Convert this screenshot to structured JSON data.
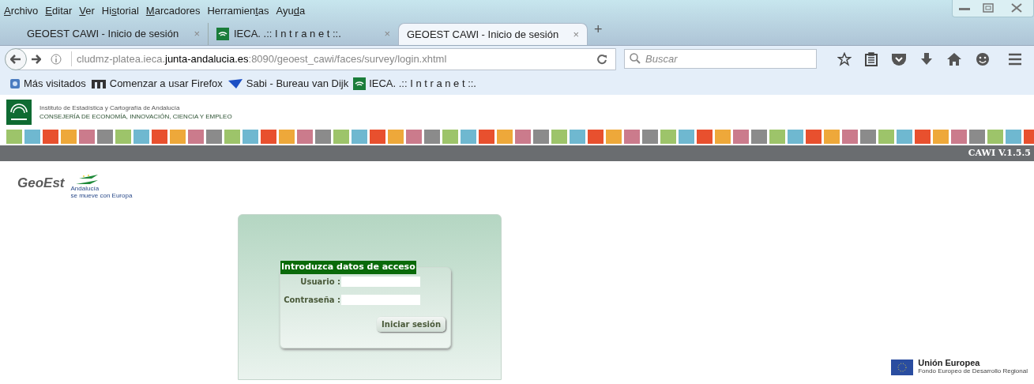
{
  "menu_bar": [
    {
      "accel": "A",
      "after": "rchivo"
    },
    {
      "accel": "E",
      "after": "ditar"
    },
    {
      "accel": "V",
      "after": "er"
    },
    {
      "before": "Hi",
      "accel": "s",
      "after": "torial"
    },
    {
      "accel": "M",
      "after": "arcadores"
    },
    {
      "before": "Herramien",
      "accel": "t",
      "after": "as"
    },
    {
      "before": "Ayu",
      "accel": "d",
      "after": "a"
    }
  ],
  "tabs": [
    {
      "title": "GEOEST CAWI - Inicio de sesión",
      "close": "×",
      "favicon": false,
      "selected": false
    },
    {
      "title": "IECA. .:: I n t r a n e t ::.",
      "close": "×",
      "favicon": true,
      "selected": false
    },
    {
      "title": "GEOEST CAWI - Inicio de sesión",
      "close": "×",
      "favicon": false,
      "selected": true
    }
  ],
  "new_tab": "+",
  "address": {
    "host_prefix": "cludmz-platea.ieca.",
    "domain": "junta-andalucia.es",
    "path": ":8090/geoest_cawi/faces/survey/login.xhtml"
  },
  "search": {
    "placeholder": "Buscar"
  },
  "bookmarks": [
    {
      "label": "Más visitados",
      "kind": "folder"
    },
    {
      "label": "Comenzar a usar Firefox",
      "kind": "m"
    },
    {
      "label": "Sabi - Bureau van Dijk",
      "kind": "sabi"
    },
    {
      "label": "IECA. .:: I n t r a n e t ::.",
      "kind": "ieca"
    }
  ],
  "header": {
    "institute": "Instituto de Estadística y Cartografía de Andalucía",
    "ministry": "CONSEJERÍA DE ECONOMÍA, INNOVACIÓN, CIENCIA Y EMPLEO",
    "version": "CAWI V.1.5.5"
  },
  "brand": {
    "name": "GeoEst",
    "slogan_1": "Andalucía",
    "slogan_2": "se mueve con Europa"
  },
  "login": {
    "legend": "Introduzca datos de acceso",
    "user_label": "Usuario :",
    "password_label": "Contraseña :",
    "submit": "Iniciar sesión"
  },
  "eu": {
    "name": "Unión Europea",
    "fund": "Fondo Europeo de Desarrollo Regional"
  }
}
